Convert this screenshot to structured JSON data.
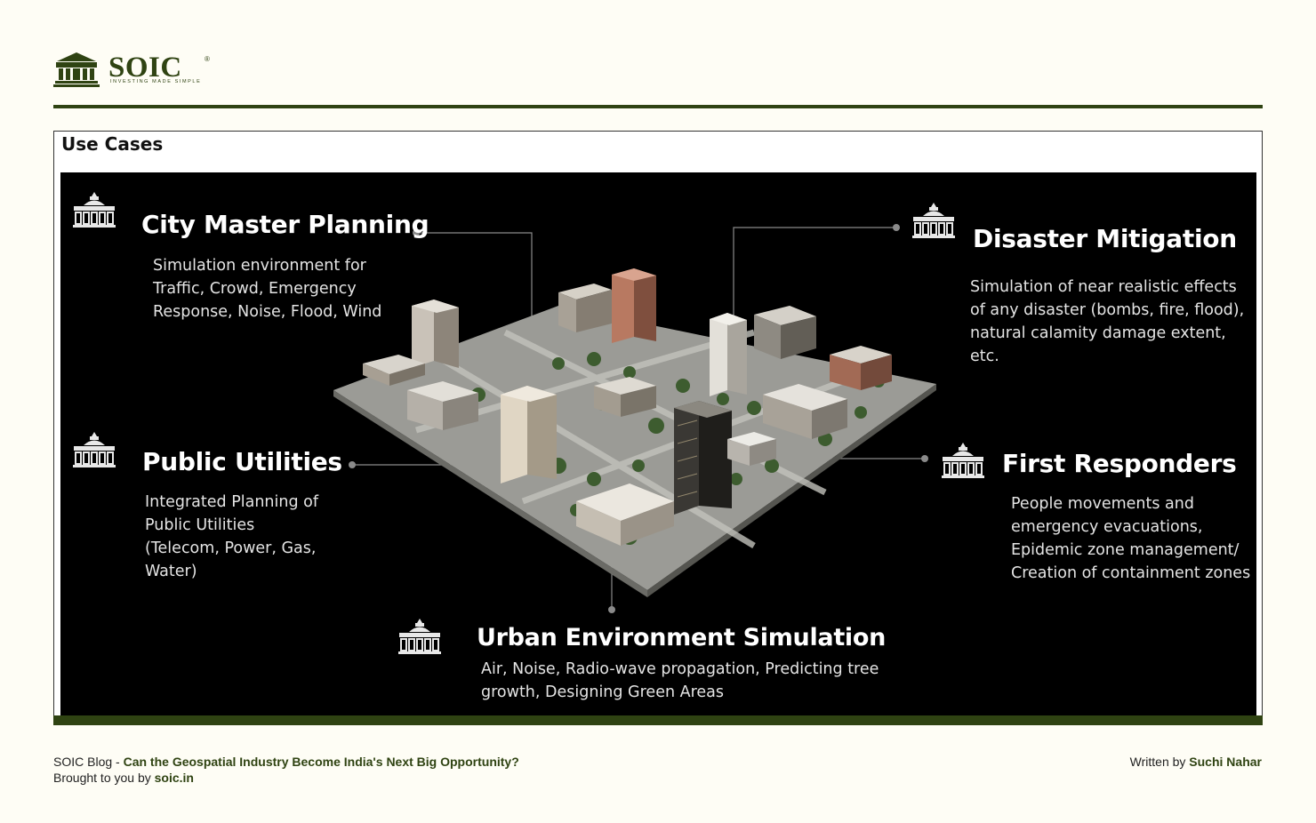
{
  "brand": {
    "name": "SOIC",
    "registered_mark": "®",
    "tagline": "INVESTING MADE SIMPLE",
    "logo_icon": "bank-building-icon",
    "color": "#2f4312"
  },
  "section": {
    "title": "Use Cases"
  },
  "use_cases": [
    {
      "icon": "government-building-icon",
      "title": "City Master Planning",
      "description": [
        "Simulation environment for",
        "Traffic, Crowd, Emergency",
        "Response, Noise, Flood, Wind"
      ]
    },
    {
      "icon": "government-building-icon",
      "title": "Disaster Mitigation",
      "description": [
        "Simulation of near realistic effects",
        "of any disaster (bombs, fire, flood),",
        "natural calamity damage extent,",
        "etc."
      ]
    },
    {
      "icon": "government-building-icon",
      "title": "Public Utilities",
      "description": [
        "Integrated Planning of",
        "Public Utilities",
        "(Telecom, Power, Gas,",
        "Water)"
      ]
    },
    {
      "icon": "government-building-icon",
      "title": "First Responders",
      "description": [
        "People movements and",
        "emergency evacuations,",
        "Epidemic zone management/",
        "Creation of containment zones"
      ]
    },
    {
      "icon": "government-building-icon",
      "title": "Urban Environment Simulation",
      "description": [
        "Air, Noise, Radio-wave propagation, Predicting tree",
        "growth, Designing Green Areas"
      ]
    }
  ],
  "footer": {
    "blog_prefix": "SOIC Blog - ",
    "blog_title": "Can the Geospatial Industry Become India's Next Big Opportunity?",
    "brought_prefix": "Brought to you by ",
    "site": "soic.in",
    "written_prefix": "Written by ",
    "author": "Suchi Nahar"
  }
}
